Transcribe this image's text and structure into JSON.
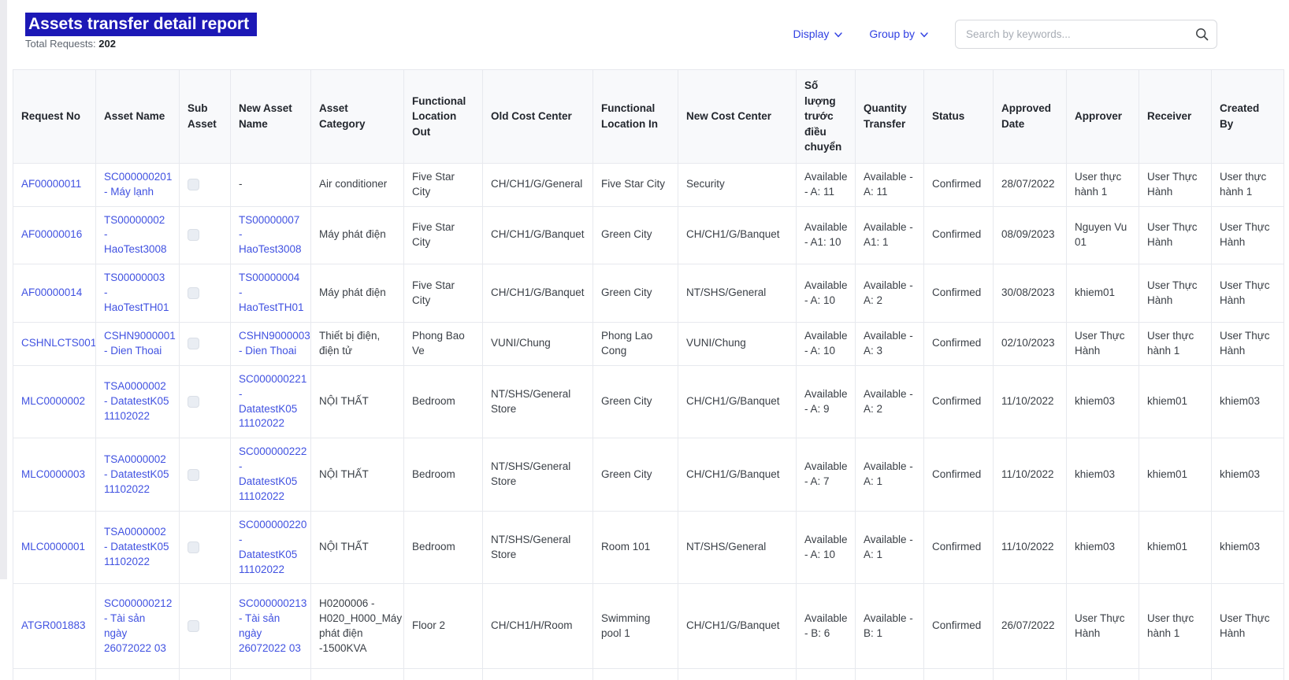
{
  "page": {
    "title": "Assets transfer detail report",
    "total_requests_label": "Total Requests:",
    "total_requests_value": "202"
  },
  "toolbar": {
    "display_label": "Display",
    "group_by_label": "Group by",
    "search_placeholder": "Search by keywords...",
    "search_value": ""
  },
  "icons": {
    "display_caret": "chevron-down",
    "group_by_caret": "chevron-down",
    "search": "magnifying-glass"
  },
  "colors": {
    "title_highlight": "#1c18b6",
    "accent_link": "#4152e1",
    "control_link": "#3040e2",
    "header_bg": "#f8f9fb",
    "border": "#e7e9ee"
  },
  "table": {
    "columns": [
      {
        "key": "request_no",
        "label": "Request No"
      },
      {
        "key": "asset_name",
        "label": "Asset Name"
      },
      {
        "key": "sub_asset",
        "label": "Sub Asset"
      },
      {
        "key": "new_asset_name",
        "label": "New Asset Name"
      },
      {
        "key": "asset_category",
        "label": "Asset Category"
      },
      {
        "key": "functional_location_out",
        "label": "Functional Location Out"
      },
      {
        "key": "old_cost_center",
        "label": "Old Cost Center"
      },
      {
        "key": "functional_location_in",
        "label": "Functional Location In"
      },
      {
        "key": "new_cost_center",
        "label": "New Cost Center"
      },
      {
        "key": "qty_before_transfer",
        "label": "Số lượng trước điều chuyển"
      },
      {
        "key": "quantity_transfer",
        "label": "Quantity Transfer"
      },
      {
        "key": "status",
        "label": "Status"
      },
      {
        "key": "approved_date",
        "label": "Approved Date"
      },
      {
        "key": "approver",
        "label": "Approver"
      },
      {
        "key": "receiver",
        "label": "Receiver"
      },
      {
        "key": "created_by",
        "label": "Created By"
      }
    ],
    "rows": [
      {
        "request_no": "AF00000011",
        "asset_name": "SC000000201 - Máy lạnh",
        "sub_asset_checked": false,
        "new_asset_name": "-",
        "asset_category": "Air conditioner",
        "functional_location_out": "Five Star City",
        "old_cost_center": "CH/CH1/G/General",
        "functional_location_in": "Five Star City",
        "new_cost_center": "Security",
        "qty_before_transfer": "Available - A: 11",
        "quantity_transfer": "Available - A: 11",
        "status": "Confirmed",
        "approved_date": "28/07/2022",
        "approver": "User thực hành 1",
        "receiver": "User Thực Hành",
        "created_by": "User thực hành 1"
      },
      {
        "request_no": "AF00000016",
        "asset_name": "TS00000002 - HaoTest3008",
        "sub_asset_checked": false,
        "new_asset_name": "TS00000007 - HaoTest3008",
        "asset_category": "Máy phát điện",
        "functional_location_out": "Five Star City",
        "old_cost_center": "CH/CH1/G/Banquet",
        "functional_location_in": "Green City",
        "new_cost_center": "CH/CH1/G/Banquet",
        "qty_before_transfer": "Available - A1: 10",
        "quantity_transfer": "Available - A1: 1",
        "status": "Confirmed",
        "approved_date": "08/09/2023",
        "approver": "Nguyen Vu 01",
        "receiver": "User Thực Hành",
        "created_by": "User Thực Hành"
      },
      {
        "request_no": "AF00000014",
        "asset_name": "TS00000003 - HaoTestTH01",
        "sub_asset_checked": false,
        "new_asset_name": "TS00000004 - HaoTestTH01",
        "asset_category": "Máy phát điện",
        "functional_location_out": "Five Star City",
        "old_cost_center": "CH/CH1/G/Banquet",
        "functional_location_in": "Green City",
        "new_cost_center": "NT/SHS/General",
        "qty_before_transfer": "Available - A: 10",
        "quantity_transfer": "Available - A: 2",
        "status": "Confirmed",
        "approved_date": "30/08/2023",
        "approver": "khiem01",
        "receiver": "User Thực Hành",
        "created_by": "User Thực Hành"
      },
      {
        "request_no": "CSHNLCTS001",
        "asset_name": "CSHN9000001 - Dien Thoai",
        "sub_asset_checked": false,
        "new_asset_name": "CSHN9000003 - Dien Thoai",
        "asset_category": "Thiết bị điện, điện tử",
        "functional_location_out": "Phong Bao Ve",
        "old_cost_center": "VUNI/Chung",
        "functional_location_in": "Phong Lao Cong",
        "new_cost_center": "VUNI/Chung",
        "qty_before_transfer": "Available - A: 10",
        "quantity_transfer": "Available - A: 3",
        "status": "Confirmed",
        "approved_date": "02/10/2023",
        "approver": "User Thực Hành",
        "receiver": "User thực hành 1",
        "created_by": "User Thực Hành"
      },
      {
        "request_no": "MLC0000002",
        "asset_name": "TSA0000002 - DatatestK05 11102022",
        "sub_asset_checked": false,
        "new_asset_name": "SC000000221 - DatatestK05 11102022",
        "asset_category": "NỘI THẤT",
        "functional_location_out": "Bedroom",
        "old_cost_center": "NT/SHS/General Store",
        "functional_location_in": "Green City",
        "new_cost_center": "CH/CH1/G/Banquet",
        "qty_before_transfer": "Available - A: 9",
        "quantity_transfer": "Available - A: 2",
        "status": "Confirmed",
        "approved_date": "11/10/2022",
        "approver": "khiem03",
        "receiver": "khiem01",
        "created_by": "khiem03"
      },
      {
        "request_no": "MLC0000003",
        "asset_name": "TSA0000002 - DatatestK05 11102022",
        "sub_asset_checked": false,
        "new_asset_name": "SC000000222 - DatatestK05 11102022",
        "asset_category": "NỘI THẤT",
        "functional_location_out": "Bedroom",
        "old_cost_center": "NT/SHS/General Store",
        "functional_location_in": "Green City",
        "new_cost_center": "CH/CH1/G/Banquet",
        "qty_before_transfer": "Available - A: 7",
        "quantity_transfer": "Available - A: 1",
        "status": "Confirmed",
        "approved_date": "11/10/2022",
        "approver": "khiem03",
        "receiver": "khiem01",
        "created_by": "khiem03"
      },
      {
        "request_no": "MLC0000001",
        "asset_name": "TSA0000002 - DatatestK05 11102022",
        "sub_asset_checked": false,
        "new_asset_name": "SC000000220 - DatatestK05 11102022",
        "asset_category": "NỘI THẤT",
        "functional_location_out": "Bedroom",
        "old_cost_center": "NT/SHS/General Store",
        "functional_location_in": "Room 101",
        "new_cost_center": "NT/SHS/General",
        "qty_before_transfer": "Available - A: 10",
        "quantity_transfer": "Available - A: 1",
        "status": "Confirmed",
        "approved_date": "11/10/2022",
        "approver": "khiem03",
        "receiver": "khiem01",
        "created_by": "khiem03"
      },
      {
        "request_no": "ATGR001883",
        "asset_name": "SC000000212 - Tài sản ngày 26072022 03",
        "sub_asset_checked": false,
        "new_asset_name": "SC000000213 - Tài sản ngày 26072022 03",
        "asset_category": "H0200006 - H020_H000_Máy phát điện -1500KVA",
        "functional_location_out": "Floor 2",
        "old_cost_center": "CH/CH1/H/Room",
        "functional_location_in": "Swimming pool 1",
        "new_cost_center": "CH/CH1/G/Banquet",
        "qty_before_transfer": "Available - B: 6",
        "quantity_transfer": "Available - B: 1",
        "status": "Confirmed",
        "approved_date": "26/07/2022",
        "approver": "User Thực Hành",
        "receiver": "User thực hành 1",
        "created_by": "User Thực Hành"
      }
    ]
  }
}
